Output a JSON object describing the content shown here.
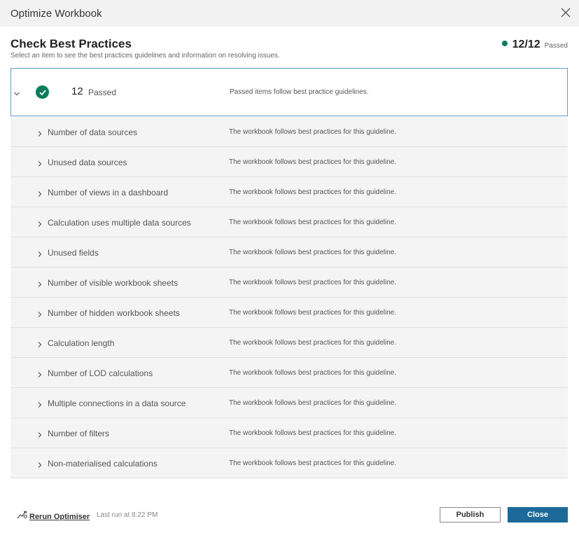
{
  "window": {
    "title": "Optimize Workbook",
    "close_icon": "close-icon"
  },
  "header": {
    "title": "Check Best Practices",
    "subtitle": "Select an item to see the best practices guidelines and information on resolving issues.",
    "summary_count": "12/12",
    "summary_label": "Passed",
    "status_color": "#0a7c5a"
  },
  "group": {
    "count": "12",
    "label": "Passed",
    "description": "Passed items follow best practice guidelines.",
    "icon": "check-circle-icon",
    "expanded": true
  },
  "items": [
    {
      "name": "Number of data sources",
      "description": "The workbook follows best practices for this guideline."
    },
    {
      "name": "Unused data sources",
      "description": "The workbook follows best practices for this guideline."
    },
    {
      "name": "Number of views in a dashboard",
      "description": "The workbook follows best practices for this guideline."
    },
    {
      "name": "Calculation uses multiple data sources",
      "description": "The workbook follows best practices for this guideline."
    },
    {
      "name": "Unused fields",
      "description": "The workbook follows best practices for this guideline."
    },
    {
      "name": "Number of visible workbook sheets",
      "description": "The workbook follows best practices for this guideline."
    },
    {
      "name": "Number of hidden workbook sheets",
      "description": "The workbook follows best practices for this guideline."
    },
    {
      "name": "Calculation length",
      "description": "The workbook follows best practices for this guideline."
    },
    {
      "name": "Number of LOD calculations",
      "description": "The workbook follows best practices for this guideline."
    },
    {
      "name": "Multiple connections in a data source",
      "description": "The workbook follows best practices for this guideline."
    },
    {
      "name": "Number of filters",
      "description": "The workbook follows best practices for this guideline."
    },
    {
      "name": "Non-materialised calculations",
      "description": "The workbook follows best practices for this guideline."
    }
  ],
  "footer": {
    "rerun_label": "Rerun Optimiser",
    "rerun_icon": "rerun-icon",
    "last_run": "Last run at 8:22 PM",
    "publish_label": "Publish",
    "close_label": "Close",
    "accent_color": "#1b6a9a"
  }
}
